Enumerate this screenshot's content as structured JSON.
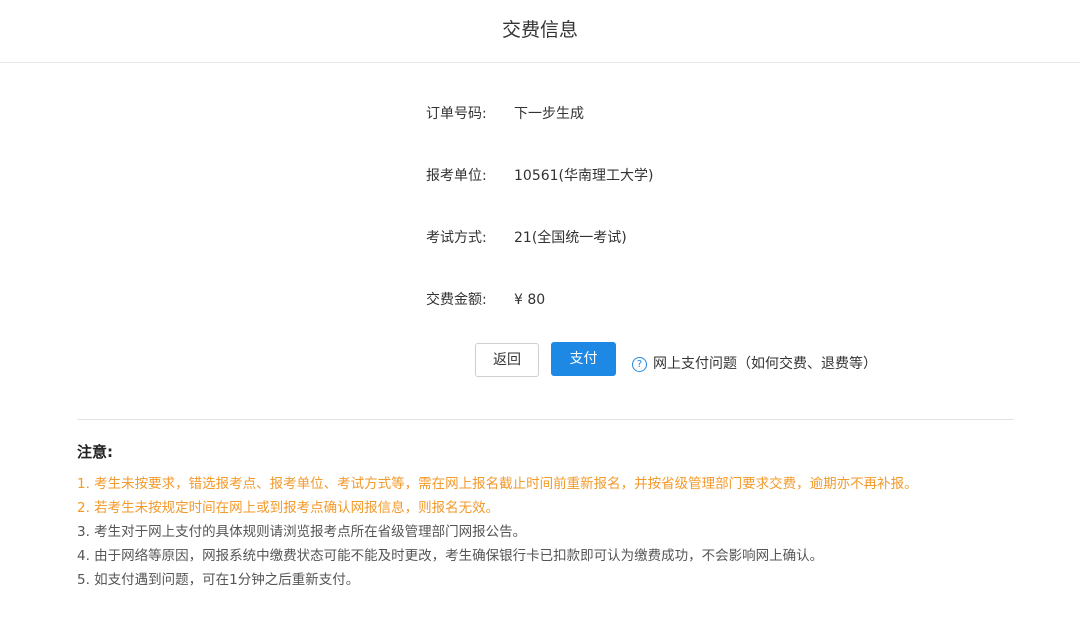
{
  "header": {
    "title": "交费信息"
  },
  "order_info": {
    "order_no": {
      "label": "订单号码:",
      "value": "下一步生成"
    },
    "exam_unit": {
      "label": "报考单位:",
      "value": "10561(华南理工大学)"
    },
    "exam_mode": {
      "label": "考试方式:",
      "value": "21(全国统一考试)"
    },
    "fee_amount": {
      "label": "交费金额:",
      "value": "¥ 80"
    }
  },
  "actions": {
    "back_label": "返回",
    "pay_label": "支付",
    "help_icon": "question-circle-icon",
    "help_text": "网上支付问题（如何交费、退费等）"
  },
  "notes": {
    "title": "注意:",
    "items": [
      "1. 考生未按要求，错选报考点、报考单位、考试方式等，需在网上报名截止时间前重新报名，并按省级管理部门要求交费，逾期亦不再补报。",
      "2. 若考生未按规定时间在网上或到报考点确认网报信息，则报名无效。",
      "3. 考生对于网上支付的具体规则请浏览报考点所在省级管理部门网报公告。",
      "4. 由于网络等原因，网报系统中缴费状态可能不能及时更改，考生确保银行卡已扣款即可认为缴费成功，不会影响网上确认。",
      "5. 如支付遇到问题，可在1分钟之后重新支付。"
    ]
  },
  "colors": {
    "primary": "#1e88e5",
    "warning": "#f39a2b",
    "text": "#333333"
  }
}
